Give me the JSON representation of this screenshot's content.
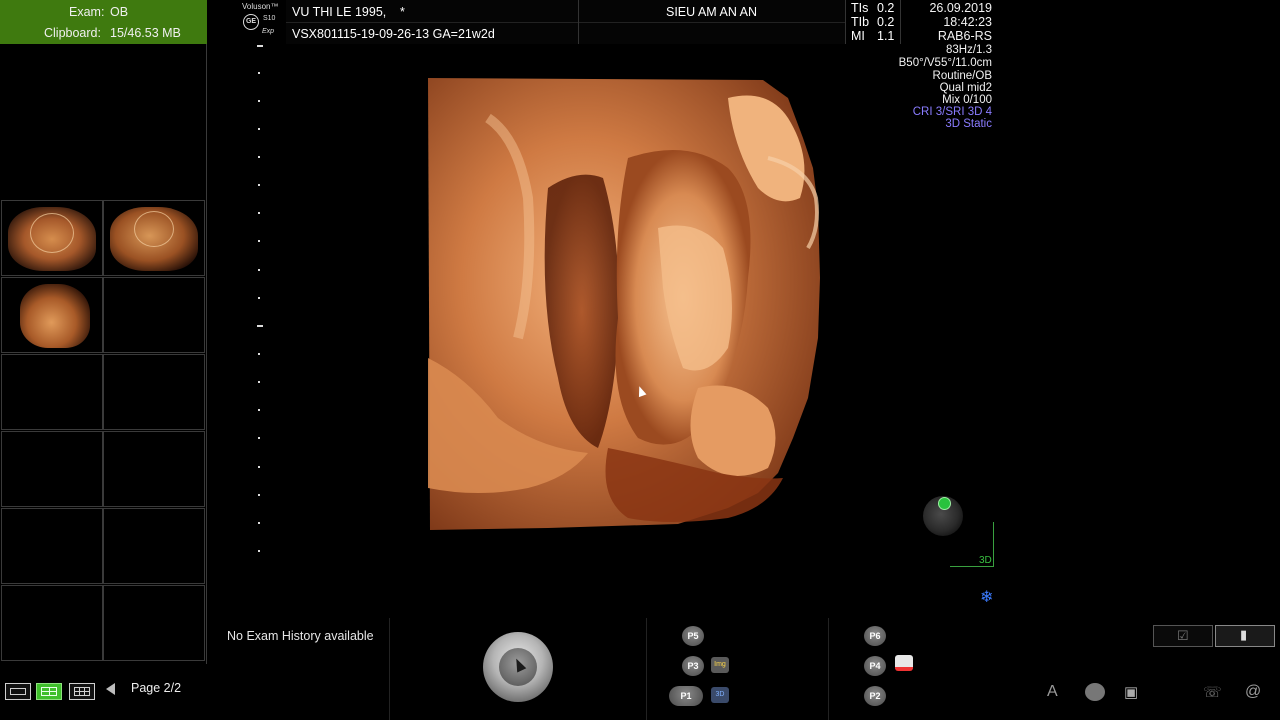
{
  "exam_panel": {
    "exam_label": "Exam:",
    "exam_value": "OB",
    "clipboard_label": "Clipboard:",
    "clipboard_value": "15/46.53 MB"
  },
  "thumbnails_panel": {
    "page_label": "Page 2/2",
    "layout_buttons": [
      "layout-1x1-icon",
      "layout-2x4-icon",
      "layout-3x4-icon"
    ]
  },
  "logo": {
    "brand": "Voluson™",
    "ge": "GE",
    "model": "S10",
    "edition": "Exp"
  },
  "header": {
    "patient_name": "VU THI LE 1995,",
    "patient_marker": "*",
    "exam_id": "VSX801115-19-09-26-13  GA=21w2d",
    "hospital": "SIEU AM AN AN",
    "indices": [
      {
        "label": "TIs",
        "value": "0.2"
      },
      {
        "label": "TIb",
        "value": "0.2"
      },
      {
        "label": "MI",
        "value": "1.1"
      }
    ],
    "date": "26.09.2019",
    "time": "18:42:23"
  },
  "imaging_params": {
    "lines": [
      "RAB6-RS",
      "83Hz/1.3",
      "B50°/V55°/11.0cm",
      "Routine/OB",
      "Qual mid2",
      "Mix 0/100"
    ],
    "highlight_lines": [
      "CRI 3/SRI 3D 4",
      "3D Static"
    ],
    "highlight_color": "#8a7cff"
  },
  "orientation": {
    "label": "3D",
    "accent": "#29c23d"
  },
  "bottom": {
    "exam_history": "No Exam History available",
    "p_buttons": [
      "P5",
      "P3",
      "P1",
      "P6",
      "P4",
      "P2"
    ],
    "img_label": "Img",
    "three_d_label": "3D",
    "text_icon_label": "A",
    "at_label": "@"
  },
  "colors": {
    "exam_bg": "#3f7a0f",
    "active_layout": "#3fbf2b",
    "render_tone": "#c46a36"
  }
}
